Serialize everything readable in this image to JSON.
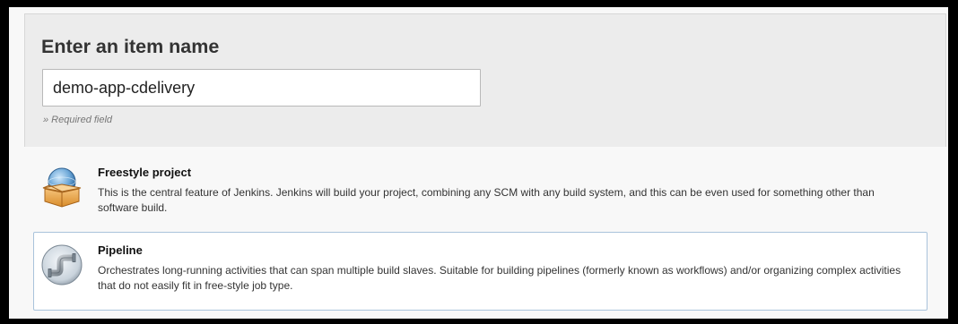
{
  "form": {
    "title": "Enter an item name",
    "name_value": "demo-app-cdelivery",
    "required_note": "» Required field"
  },
  "item_types": [
    {
      "name": "Freestyle project",
      "description": "This is the central feature of Jenkins. Jenkins will build your project, combining any SCM with any build system, and this can be even used for something other than software build.",
      "icon": "freestyle-box-icon",
      "selected": false
    },
    {
      "name": "Pipeline",
      "description": "Orchestrates long-running activities that can span multiple build slaves. Suitable for building pipelines (formerly known as workflows) and/or organizing complex activities that do not easily fit in free-style job type.",
      "icon": "pipeline-pipe-icon",
      "selected": true
    }
  ],
  "colors": {
    "selected_border": "#a9c3db",
    "header_background": "#ececec"
  }
}
